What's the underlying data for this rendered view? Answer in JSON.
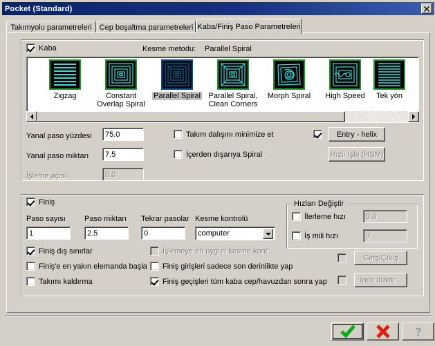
{
  "window": {
    "title": "Pocket (Standard)",
    "close_label": "✕"
  },
  "tabs": [
    {
      "label": "Takımyolu parametreleri",
      "active": false
    },
    {
      "label": "Cep boşaltma parametreleri",
      "active": false
    },
    {
      "label": "Kaba/Finiş Paso Parametreleri",
      "active": true
    }
  ],
  "rough": {
    "enable_label": "Kaba",
    "enable_checked": true,
    "method_label": "Kesme metodu:",
    "method_value": "Parallel Spiral",
    "methods": [
      {
        "name": "Zigzag",
        "selected": false
      },
      {
        "name": "Constant\nOverlap Spiral",
        "selected": false
      },
      {
        "name": "Parallel Spiral",
        "selected": true
      },
      {
        "name": "Parallel Spiral,\nClean Corners",
        "selected": false
      },
      {
        "name": "Morph Spiral",
        "selected": false
      },
      {
        "name": "High Speed",
        "selected": false
      },
      {
        "name": "Tek yön",
        "selected": false
      }
    ],
    "stepover_pct_label": "Yanal paso yüzdesi",
    "stepover_pct_value": "75.0",
    "stepover_amt_label": "Yanal paso miktarı",
    "stepover_amt_value": "7.5",
    "angle_label": "İşleme açısı",
    "angle_value": "0.0",
    "angle_disabled": true,
    "minimize_plunge_label": "Takım dalışını minimize et",
    "minimize_plunge_checked": false,
    "spiral_inside_out_label": "İçerden dışarıya Spiral",
    "spiral_inside_out_checked": false,
    "entry_checked": true,
    "entry_button_label": "Entry - helix",
    "hsm_button_label": "Hızlı İşle (HSM)",
    "hsm_disabled": true
  },
  "finish": {
    "enable_label": "Finiş",
    "enable_checked": true,
    "passes_label": "Paso sayısı",
    "passes_value": "1",
    "spacing_label": "Paso miktarı",
    "spacing_value": "2.5",
    "repeat_label": "Tekrar pasolar",
    "repeat_value": "0",
    "cutter_comp_label": "Kesme kontrolü",
    "cutter_comp_value": "computer",
    "cutter_comp_options": [
      "computer"
    ],
    "checks_left": [
      {
        "label": "Finiş dış sınırlar",
        "checked": true,
        "disabled": false
      },
      {
        "label": "Finiş'e en yakın elemanda başla",
        "checked": false,
        "disabled": false
      },
      {
        "label": "Takımı kaldırma",
        "checked": false,
        "disabled": false
      }
    ],
    "checks_right": [
      {
        "label": "İşlemeye en uygun kesme kont",
        "checked": false,
        "disabled": true
      },
      {
        "label": "Finiş girişleri sadece son derinlikte yap",
        "checked": false,
        "disabled": false
      },
      {
        "label": "Finiş geçişleri tüm kaba cep/havuzdan sonra yap",
        "checked": true,
        "disabled": false
      }
    ],
    "speeds_group_label": "Hızları Değiştir",
    "feed_label": "İlerleme hızı",
    "feed_checked": false,
    "feed_value": "0.0",
    "feed_disabled": true,
    "spindle_label": "İş mili hızı",
    "spindle_checked": false,
    "spindle_value": "0",
    "spindle_disabled": true,
    "lead_checked": false,
    "lead_button_label": "Giriş/Çıkış",
    "lead_disabled": true,
    "thin_checked": false,
    "thin_button_label": "İnce duvar...",
    "thin_disabled": true
  },
  "footer": {
    "ok_icon": "checkmark-icon",
    "cancel_icon": "cross-icon",
    "help_icon": "question-mark-icon"
  }
}
